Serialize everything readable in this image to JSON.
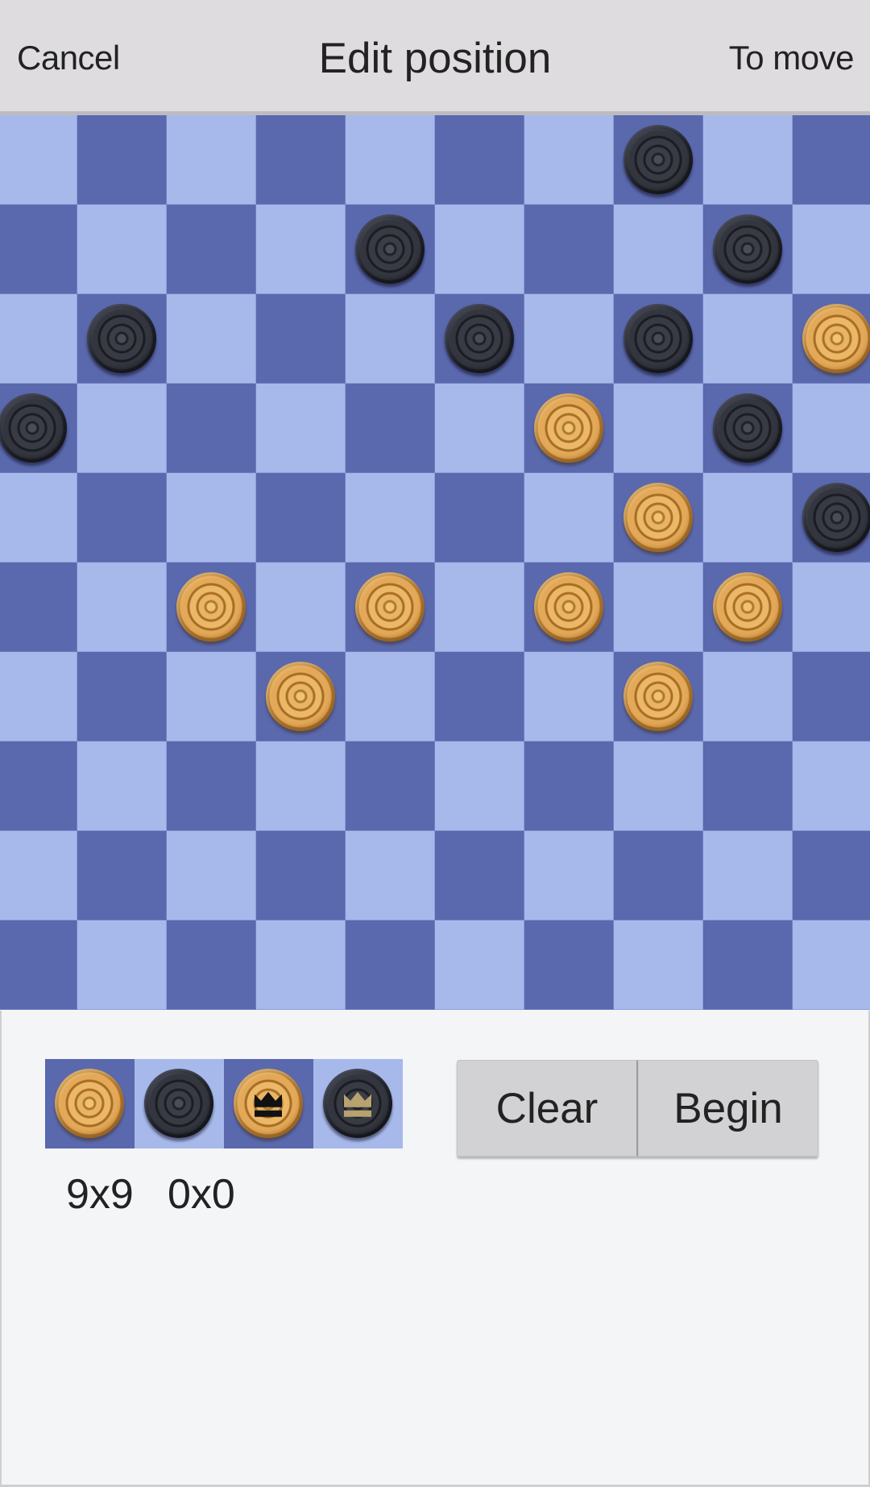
{
  "header": {
    "cancel_label": "Cancel",
    "title": "Edit position",
    "to_move_label": "To move"
  },
  "board": {
    "rows": 10,
    "cols": 10,
    "colors": {
      "light": "#a7b8ea",
      "dark": "#5a68ad"
    },
    "pieces": [
      {
        "row": 0,
        "col": 7,
        "color": "black",
        "king": false
      },
      {
        "row": 1,
        "col": 4,
        "color": "black",
        "king": false
      },
      {
        "row": 1,
        "col": 8,
        "color": "black",
        "king": false
      },
      {
        "row": 2,
        "col": 1,
        "color": "black",
        "king": false
      },
      {
        "row": 2,
        "col": 5,
        "color": "black",
        "king": false
      },
      {
        "row": 2,
        "col": 7,
        "color": "black",
        "king": false
      },
      {
        "row": 2,
        "col": 9,
        "color": "white",
        "king": false
      },
      {
        "row": 3,
        "col": 0,
        "color": "black",
        "king": false
      },
      {
        "row": 3,
        "col": 6,
        "color": "white",
        "king": false
      },
      {
        "row": 3,
        "col": 8,
        "color": "black",
        "king": false
      },
      {
        "row": 4,
        "col": 7,
        "color": "white",
        "king": false
      },
      {
        "row": 4,
        "col": 9,
        "color": "black",
        "king": false
      },
      {
        "row": 5,
        "col": 2,
        "color": "white",
        "king": false
      },
      {
        "row": 5,
        "col": 4,
        "color": "white",
        "king": false
      },
      {
        "row": 5,
        "col": 6,
        "color": "white",
        "king": false
      },
      {
        "row": 5,
        "col": 8,
        "color": "white",
        "king": false
      },
      {
        "row": 6,
        "col": 3,
        "color": "white",
        "king": false
      },
      {
        "row": 6,
        "col": 7,
        "color": "white",
        "king": false
      }
    ]
  },
  "palette": [
    {
      "name": "white-man",
      "color": "white",
      "king": false,
      "bg": "dark"
    },
    {
      "name": "black-man",
      "color": "black",
      "king": false,
      "bg": "light"
    },
    {
      "name": "white-king",
      "color": "white",
      "king": true,
      "bg": "dark"
    },
    {
      "name": "black-king",
      "color": "black",
      "king": true,
      "bg": "light"
    }
  ],
  "counts": {
    "first": "9x9",
    "second": "0x0"
  },
  "buttons": {
    "clear_label": "Clear",
    "begin_label": "Begin"
  }
}
